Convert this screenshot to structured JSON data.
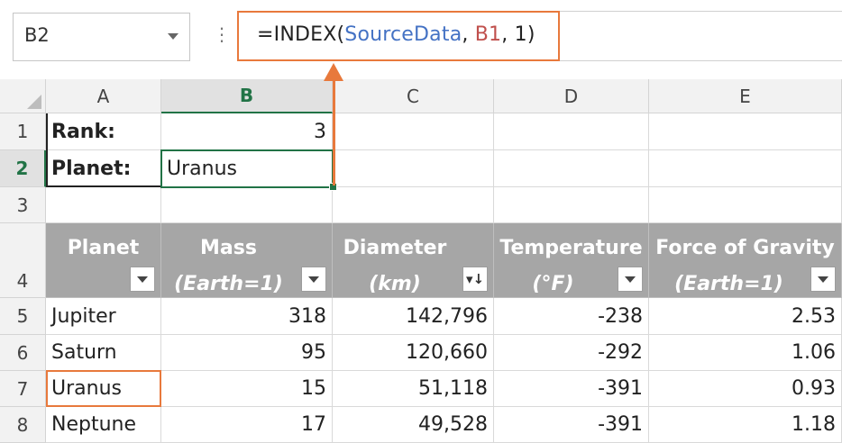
{
  "name_box": "B2",
  "formula": {
    "prefix": "=INDEX(",
    "arg1": "SourceData",
    "sep1": ", ",
    "arg2": "B1",
    "sep2": ", ",
    "arg3": "1",
    "suffix": ")"
  },
  "columns": [
    "A",
    "B",
    "C",
    "D",
    "E"
  ],
  "rows": [
    "1",
    "2",
    "3",
    "4",
    "5",
    "6",
    "7",
    "8"
  ],
  "cells": {
    "A1": "Rank:",
    "B1": "3",
    "A2": "Planet:",
    "B2": "Uranus"
  },
  "table_headers": [
    {
      "line1": "Planet",
      "line2": ""
    },
    {
      "line1": "Mass",
      "line2": "(Earth=1)"
    },
    {
      "line1": "Diameter",
      "line2": "(km)"
    },
    {
      "line1": "Temperature",
      "line2": "(°F)"
    },
    {
      "line1": "Force of Gravity",
      "line2": "(Earth=1)"
    }
  ],
  "table_rows": [
    [
      "Jupiter",
      "318",
      "142,796",
      "-238",
      "2.53"
    ],
    [
      "Saturn",
      "95",
      "120,660",
      "-292",
      "1.06"
    ],
    [
      "Uranus",
      "15",
      "51,118",
      "-391",
      "0.93"
    ],
    [
      "Neptune",
      "17",
      "49,528",
      "-391",
      "1.18"
    ]
  ],
  "colors": {
    "accent_orange": "#e8793c",
    "selection_green": "#217346",
    "range_blue": "#4472c4",
    "ref_red": "#c0504d",
    "table_header_gray": "#a6a6a6"
  }
}
